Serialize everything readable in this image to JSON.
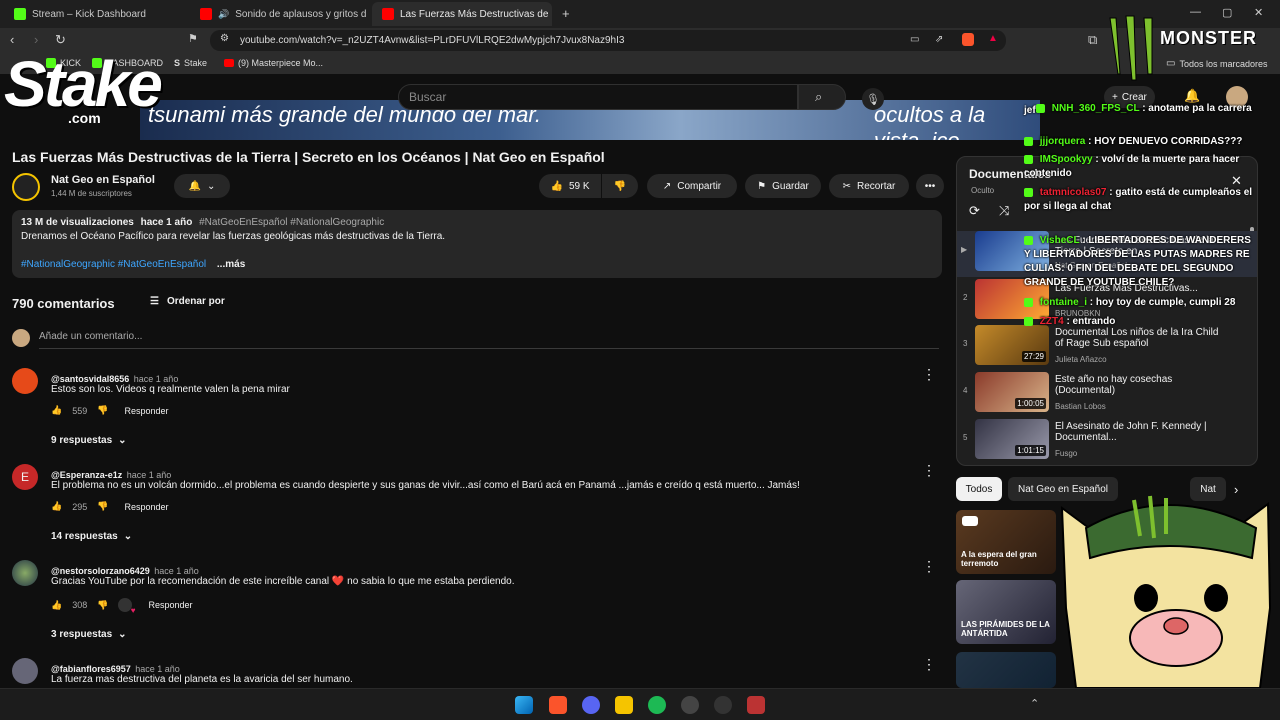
{
  "browser": {
    "tabs": [
      {
        "label": "Stream – Kick Dashboard"
      },
      {
        "label": "Sonido de aplausos y gritos d"
      },
      {
        "label": "Las Fuerzas Más Destructivas de"
      }
    ],
    "url": "youtube.com/watch?v=_n2UZT4Avnw&list=PLrDFUVlLRQE2dwMypjch7Jvux8Naz9hI3",
    "bookmarks": [
      "KICK",
      "DASHBOARD",
      "Stake",
      "(9) Masterpiece Mo..."
    ],
    "all_bookmarks": "Todos los marcadores"
  },
  "overlay": {
    "stake_logo": "Stake",
    "stake_com": ".com",
    "monster_logo": "MONSTER",
    "video_caption_left": "tsunami más grande del mundo del mar.",
    "video_caption_right": "ocultos a la vista. ico."
  },
  "header": {
    "search_placeholder": "Buscar",
    "create_label": "Crear"
  },
  "video": {
    "title": "Las Fuerzas Más Destructivas de la Tierra | Secreto en los Océanos | Nat Geo en Español",
    "channel": "Nat Geo en Español",
    "subscribers": "1,44 M de suscriptores",
    "likes": "59 K",
    "share": "Compartir",
    "save": "Guardar",
    "clip": "Recortar"
  },
  "description": {
    "stats": "13 M de visualizaciones",
    "age": "hace 1 año",
    "hashtags": "#NatGeoEnEspañol #NationalGeographic",
    "text": "Drenamos el Océano Pacífico para revelar las fuerzas geológicas más destructivas de la Tierra.",
    "tags_bottom": "#NationalGeographic #NatGeoEnEspañol",
    "more": "...más"
  },
  "comments": {
    "count": "790 comentarios",
    "sort": "Ordenar por",
    "add_placeholder": "Añade un comentario...",
    "items": [
      {
        "user": "@santosvidal8656",
        "time": "hace 1 año",
        "text": "Estos son los. Videos q realmente  valen la pena  mirar",
        "likes": "559",
        "reply": "Responder",
        "replies": "9 respuestas"
      },
      {
        "user": "@Esperanza-e1z",
        "time": "hace 1 año",
        "text": "El problema no es un volcán dormido...el problema es cuando despierte y sus ganas de vivir...así como el Barú acá en Panamá ...jamás e creído q está muerto... Jamás!",
        "likes": "295",
        "reply": "Responder",
        "replies": "14 respuestas",
        "initial": "E"
      },
      {
        "user": "@nestorsolorzano6429",
        "time": "hace 1 año",
        "text": "Gracias YouTube por la recomendación de este increíble canal ❤️  no sabia lo que me estaba perdiendo.",
        "likes": "308",
        "reply": "Responder",
        "replies": "3 respuestas"
      },
      {
        "user": "@fabianflores6957",
        "time": "hace 1 año",
        "text": "La fuerza mas destructiva del planeta es la avaricia del ser humano."
      }
    ]
  },
  "playlist": {
    "title": "Documentales",
    "subtitle": "Oculto",
    "items": [
      {
        "index": "▶",
        "title": "Las Fuerzas Más Destructivas de la Tierra | Secreto en...",
        "channel": "Nat Geo en Español",
        "duration": ""
      },
      {
        "index": "2",
        "title": "Las Fuerzas Más Destructivas...",
        "channel": "BRUNOBKN",
        "duration": ""
      },
      {
        "index": "3",
        "title": "Documental Los niños de la Ira Child of Rage Sub español",
        "channel": "Julieta Añazco",
        "duration": "27:29"
      },
      {
        "index": "4",
        "title": "Este año no hay cosechas (Documental)",
        "channel": "Bastian Lobos",
        "duration": "1:00:05"
      },
      {
        "index": "5",
        "title": "El Asesinato de John F. Kennedy | Documental...",
        "channel": "Fusgo",
        "duration": "1:01:15"
      }
    ]
  },
  "chips": [
    "Todos",
    "Nat Geo en Español",
    "Nat"
  ],
  "recommendations": [
    {
      "title": "A la espera del gran terremoto"
    },
    {
      "title": "LAS PIRÁMIDES DE LA ANTÁRTIDA"
    }
  ],
  "chat": [
    {
      "user": "",
      "text": "jefe"
    },
    {
      "user": "NNH_360_FPS_CL",
      "text": ": anotame pa la carrera"
    },
    {
      "user": "jjjorquera",
      "text": ": HOY DENUEVO CORRIDAS???"
    },
    {
      "user": "IMSpookyy",
      "text": ": volví de la muerte para hacer contenido"
    },
    {
      "user": "tatmnicolas07",
      "text": ": gatito está de cumpleaños el por si llega al chat"
    },
    {
      "user": "VisheCL",
      "text": ": LIBERTADORES DE WANDERERS Y LIBERTADORES DE LAS PUTAS MADRES RE CULIAS: 0 FIN DEL DEBATE DEL SEGUNDO GRANDE DE YOUTUBE CHILE?"
    },
    {
      "user": "fontaine_i",
      "text": ": hoy toy de cumple, cumpli 28"
    },
    {
      "user": "ZZT4",
      "text": ": entrando"
    }
  ],
  "colors": {
    "kick_green": "#53fc18",
    "youtube_red": "#ff0000",
    "link_blue": "#3ea6ff"
  }
}
